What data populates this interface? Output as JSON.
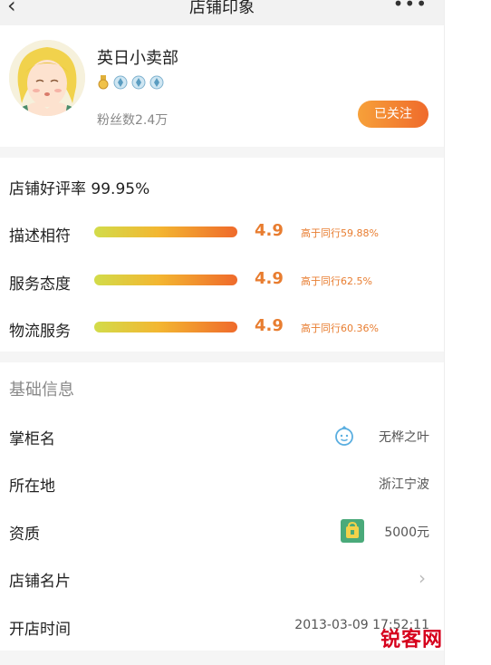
{
  "header": {
    "title": "店铺印象",
    "back_icon": "back-arrow-icon",
    "more_icon": "more-dots-icon"
  },
  "shop": {
    "name": "英日小卖部",
    "fans": "粉丝数2.4万",
    "follow_label": "已关注",
    "badge_count": 4
  },
  "ratings": {
    "overall": "店铺好评率 99.95%",
    "items": [
      {
        "label": "描述相符",
        "score": "4.9",
        "compare": "高于同行59.88%"
      },
      {
        "label": "服务态度",
        "score": "4.9",
        "compare": "高于同行62.5%"
      },
      {
        "label": "物流服务",
        "score": "4.9",
        "compare": "高于同行60.36%"
      }
    ]
  },
  "info": {
    "section_title": "基础信息",
    "rows": [
      {
        "label": "掌柜名",
        "value": "无桦之叶",
        "icon": "smiley-chat-icon"
      },
      {
        "label": "所在地",
        "value": "浙江宁波"
      },
      {
        "label": "资质",
        "value": "5000元",
        "icon": "guarantee-bag-icon"
      },
      {
        "label": "店铺名片",
        "value": ""
      },
      {
        "label": "开店时间",
        "value": "2013-03-09 17:52:11"
      }
    ]
  },
  "watermark": {
    "text": "锐客网"
  },
  "colors": {
    "accent": "#ef6a2b",
    "score": "#e87d30"
  }
}
